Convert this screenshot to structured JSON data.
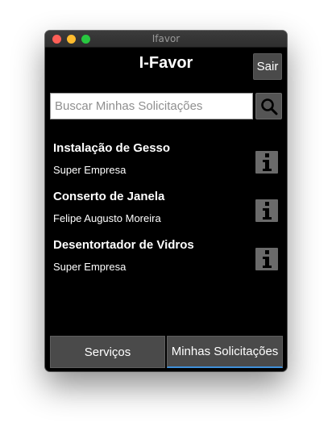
{
  "window": {
    "title": "Ifavor"
  },
  "header": {
    "title": "I-Favor",
    "logout_label": "Sair"
  },
  "search": {
    "placeholder": "Buscar Minhas Solicitações",
    "value": ""
  },
  "requests": [
    {
      "title": "Instalação de Gesso",
      "provider": "Super Empresa",
      "icon": "info-icon"
    },
    {
      "title": "Conserto de Janela",
      "provider": "Felipe Augusto Moreira",
      "icon": "info-icon"
    },
    {
      "title": "Desentortador de Vidros",
      "provider": "Super Empresa",
      "icon": "info-icon"
    }
  ],
  "tabs": [
    {
      "label": "Serviços",
      "selected": false
    },
    {
      "label": "Minhas Solicitações",
      "selected": true
    }
  ],
  "colors": {
    "background": "#000000",
    "button": "#4a4a4a",
    "tab_accent": "#3f8fd8"
  }
}
